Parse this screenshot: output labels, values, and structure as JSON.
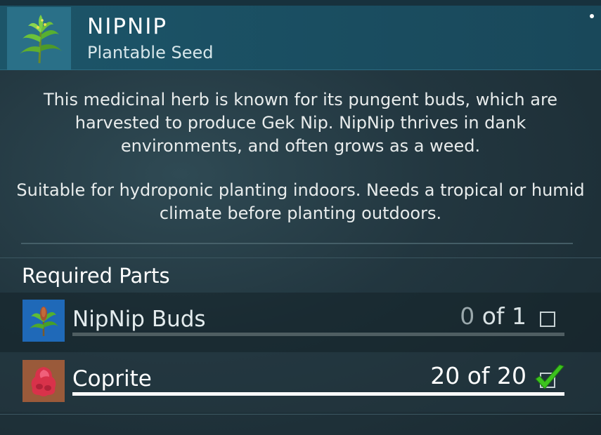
{
  "item": {
    "title": "NIPNIP",
    "subtitle": "Plantable Seed",
    "icon": "nipnip-plant-icon"
  },
  "description": {
    "paragraph1": "This medicinal herb is known for its pungent buds, which are harvested to produce Gek Nip. NipNip thrives in dank environments, and often grows as a weed.",
    "paragraph2": "Suitable for hydroponic planting indoors. Needs a tropical or humid climate before planting outdoors."
  },
  "required_parts": {
    "title": "Required Parts",
    "items": [
      {
        "name": "NipNip Buds",
        "have": "0",
        "of_label": "of 1",
        "progress": 0,
        "complete": false,
        "icon": "nipnip-buds-icon",
        "icon_bg": "#1f69b8"
      },
      {
        "name": "Coprite",
        "have": "20",
        "of_label": "of 20",
        "progress": 1,
        "complete": true,
        "icon": "coprite-icon",
        "icon_bg": "#9a5a3a"
      }
    ]
  },
  "colors": {
    "header": "#1c5569",
    "check": "#3cc21e",
    "bar_full": "#ffffff",
    "bar_empty": "#4f5e62"
  }
}
